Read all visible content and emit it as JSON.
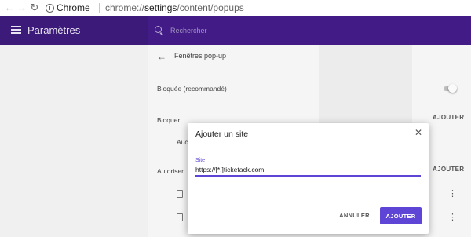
{
  "browser": {
    "site_name": "Chrome",
    "url_scheme": "chrome://",
    "url_host": "settings",
    "url_path": "/content/popups",
    "back_glyph": "←",
    "forward_glyph": "→",
    "reload_glyph": "↻"
  },
  "header": {
    "title": "Paramètres",
    "search_placeholder": "Rechercher"
  },
  "section": {
    "title": "Fenêtres pop-up",
    "back_glyph": "←",
    "blocked_label": "Bloquée (recommandé)",
    "blocked_toggle_on": false,
    "block_heading": "Bloquer",
    "block_add": "AJOUTER",
    "block_first_item_partial": "Auc",
    "allow_heading": "Autoriser",
    "allow_add": "AJOUTER",
    "more_glyph": "⋮"
  },
  "dialog": {
    "title": "Ajouter un site",
    "close_glyph": "✕",
    "field_label": "Site",
    "field_value": "https://[*.]ticketack.com",
    "cancel_label": "ANNULER",
    "add_label": "AJOUTER"
  },
  "colors": {
    "header_bg": "#3c1a7a",
    "accent": "#5f45d6"
  }
}
